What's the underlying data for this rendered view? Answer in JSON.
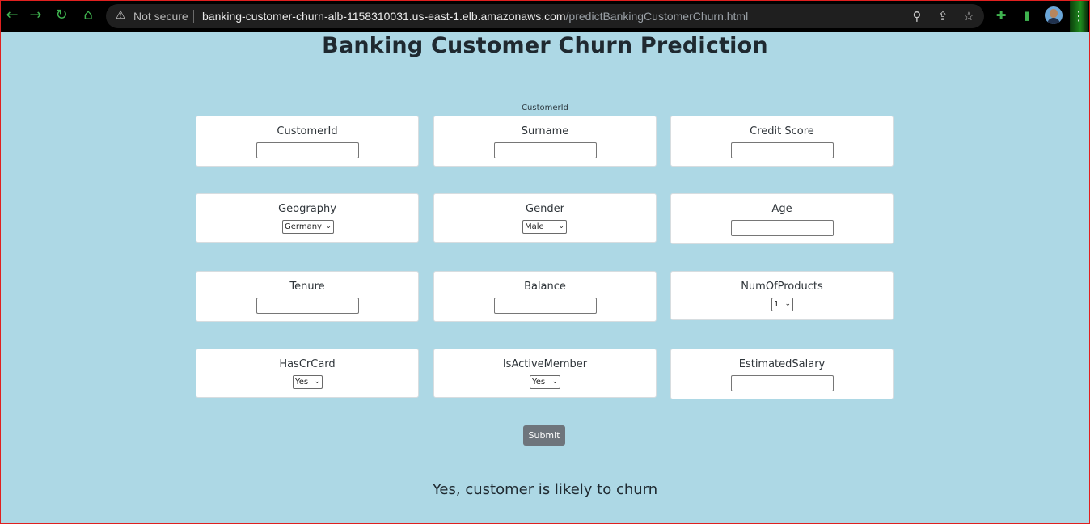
{
  "browser": {
    "security_label": "Not secure",
    "url_host": "banking-customer-churn-alb-1158310031.us-east-1.elb.amazonaws.com",
    "url_path": "/predictBankingCustomerChurn.html",
    "back_icon": "←",
    "forward_icon": "→",
    "reload_icon": "↻",
    "home_icon": "⌂",
    "warning_icon": "⚠",
    "zoom_icon": "⚲",
    "share_icon": "⇪",
    "star_icon": "☆",
    "extensions_icon": "✚",
    "sidepanel_icon": "▮",
    "menu_icon": "⋮",
    "accent_color": "#3fb34f"
  },
  "page": {
    "title": "Banking Customer Churn Prediction",
    "hint": "CustomerId",
    "background_color": "#add8e5"
  },
  "form": {
    "fields": [
      {
        "label": "CustomerId",
        "value": ""
      },
      {
        "label": "Surname",
        "value": ""
      },
      {
        "label": "Credit Score",
        "value": ""
      },
      {
        "label": "Geography",
        "selected": "Germany"
      },
      {
        "label": "Gender",
        "selected": "Male"
      },
      {
        "label": "Age",
        "value": ""
      },
      {
        "label": "Tenure",
        "value": ""
      },
      {
        "label": "Balance",
        "value": ""
      },
      {
        "label": "NumOfProducts",
        "selected": "1"
      },
      {
        "label": "HasCrCard",
        "selected": "Yes"
      },
      {
        "label": "IsActiveMember",
        "selected": "Yes"
      },
      {
        "label": "EstimatedSalary",
        "value": ""
      }
    ],
    "caret": "⌄",
    "submit_label": "Submit"
  },
  "result": {
    "message": "Yes, customer is likely to churn"
  }
}
